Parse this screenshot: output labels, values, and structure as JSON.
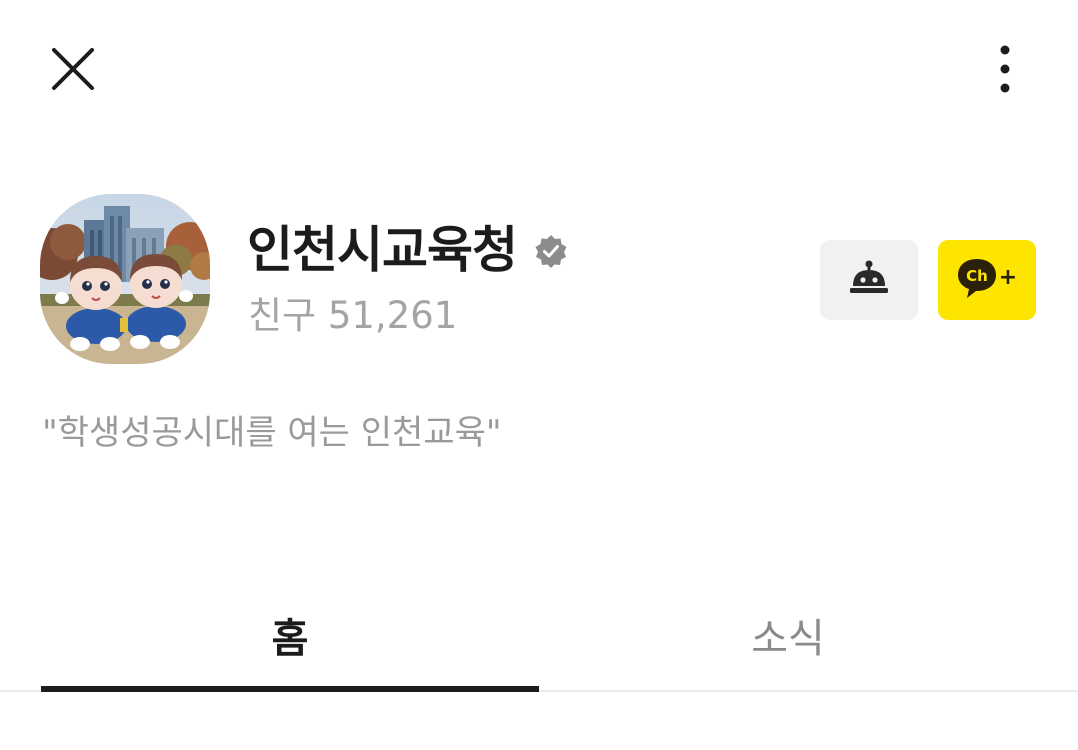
{
  "header": {
    "close_icon": "close-icon",
    "more_icon": "more-vertical-icon"
  },
  "profile": {
    "name": "인천시교육청",
    "friends": "친구 51,261",
    "verified_icon": "verified-badge-icon",
    "description": "\"학생성공시대를 여는 인천교육\""
  },
  "actions": {
    "chatbot_icon": "chatbot-icon",
    "add_channel_icon": "channel-add-icon",
    "add_channel_ch": "Ch",
    "add_channel_plus": "+"
  },
  "tabs": [
    {
      "label": "홈",
      "active": true
    },
    {
      "label": "소식",
      "active": false
    }
  ],
  "colors": {
    "accent_yellow": "#FEE500",
    "text_dark": "#1C1C1C",
    "text_gray": "#A4A4A4",
    "button_gray": "#F1F1F1"
  }
}
